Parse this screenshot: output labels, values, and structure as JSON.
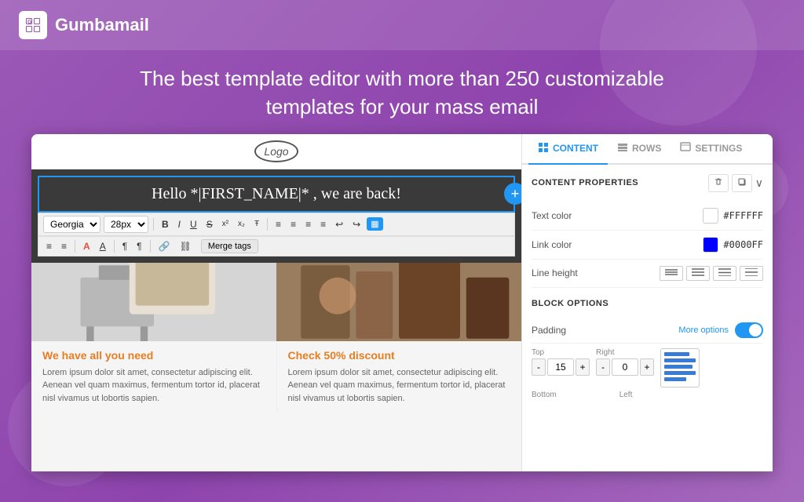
{
  "brand": {
    "name": "Gumbamail",
    "logo_alt": "G icon"
  },
  "hero": {
    "line1": "The best template editor with more than 250 customizable",
    "line2": "templates for your mass email"
  },
  "editor": {
    "logo_text": "Logo",
    "text_block": "Hello *|FIRST_NAME|* , we are back!",
    "toolbar": {
      "font_family": "Georgia",
      "font_size": "28px",
      "bold": "B",
      "italic": "I",
      "underline": "U",
      "strikethrough": "S",
      "superscript": "x²",
      "subscript": "x₂",
      "clear_format": "Ŧ",
      "align_left": "≡",
      "align_center": "≡",
      "align_right": "≡",
      "align_justify": "≡",
      "undo": "↩",
      "redo": "↪",
      "merge_tags": "Merge tags",
      "list_options": "≡",
      "indent": "≡",
      "font_color": "A",
      "highlight": "A",
      "paragraph": "¶",
      "indent2": "¶",
      "link": "🔗",
      "unlink": "🔗"
    },
    "card1": {
      "title": "We have all you need",
      "text": "Lorem ipsum dolor sit amet, consectetur adipiscing elit. Aenean vel quam maximus, fermentum tortor id, placerat nisl vivamus ut lobortis sapien."
    },
    "card2": {
      "title": "Check 50% discount",
      "text": "Lorem ipsum dolor sit amet, consectetur adipiscing elit. Aenean vel quam maximus, fermentum tortor id, placerat nisl vivamus ut lobortis sapien."
    }
  },
  "panel": {
    "tabs": [
      {
        "id": "content",
        "label": "CONTENT",
        "icon": "grid"
      },
      {
        "id": "rows",
        "label": "ROWS",
        "icon": "rows"
      },
      {
        "id": "settings",
        "label": "SETTINGS",
        "icon": "settings"
      }
    ],
    "active_tab": "content",
    "content_properties": {
      "section_title": "CONTENT PROPERTIES",
      "delete_btn": "🗑",
      "copy_btn": "⧉",
      "expand_btn": "∨",
      "text_color_label": "Text color",
      "text_color_value": "#FFFFFF",
      "text_color_hex": "#FFFFFF",
      "link_color_label": "Link color",
      "link_color_value": "#0000FF",
      "link_color_hex": "#0000FF",
      "line_height_label": "Line height",
      "line_height_options": [
        "thin",
        "normal",
        "medium",
        "wide"
      ]
    },
    "block_options": {
      "section_title": "BLOCK OPTIONS",
      "padding_label": "Padding",
      "more_options": "More options",
      "toggle_on": true,
      "top_label": "Top",
      "top_value": "15",
      "right_label": "Right",
      "right_value": "0",
      "bottom_label": "Bottom",
      "left_label": "Left"
    }
  }
}
